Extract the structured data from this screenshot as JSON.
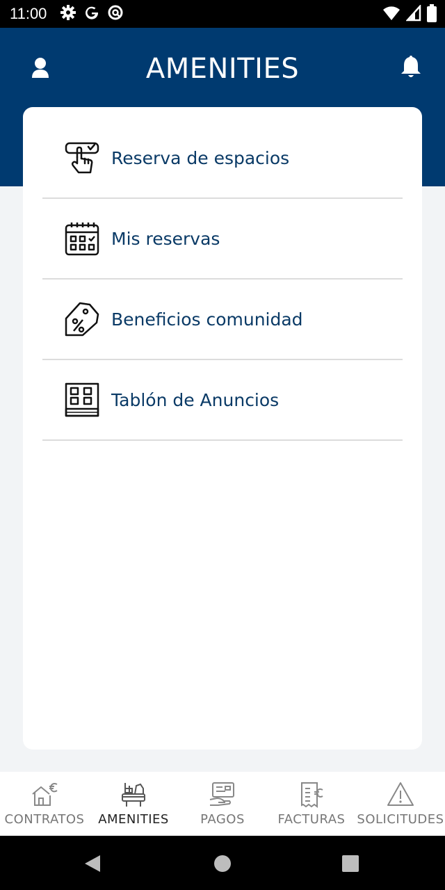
{
  "status_bar": {
    "time": "11:00",
    "left_icons": [
      "gear-icon",
      "google-icon",
      "at-icon"
    ],
    "right_icons": [
      "wifi-icon",
      "signal-icon",
      "battery-icon"
    ]
  },
  "header": {
    "title": "AMENITIES",
    "background": "#003a70"
  },
  "menu": {
    "items": [
      {
        "label": "Reserva de espacios",
        "icon": "hand-select-icon"
      },
      {
        "label": "Mis reservas",
        "icon": "calendar-icon"
      },
      {
        "label": "Beneficios comunidad",
        "icon": "discount-tag-icon"
      },
      {
        "label": "Tablón de Anuncios",
        "icon": "notice-board-icon"
      }
    ]
  },
  "bottom_nav": {
    "items": [
      {
        "label": "CONTRATOS",
        "icon": "house-euro-icon",
        "active": false
      },
      {
        "label": "AMENITIES",
        "icon": "amenities-icon",
        "active": true
      },
      {
        "label": "PAGOS",
        "icon": "payment-icon",
        "active": false
      },
      {
        "label": "FACTURAS",
        "icon": "invoice-euro-icon",
        "active": false
      },
      {
        "label": "SOLICITUDES",
        "icon": "warning-icon",
        "active": false
      }
    ]
  },
  "system_nav": [
    "back-icon",
    "home-icon",
    "recents-icon"
  ]
}
